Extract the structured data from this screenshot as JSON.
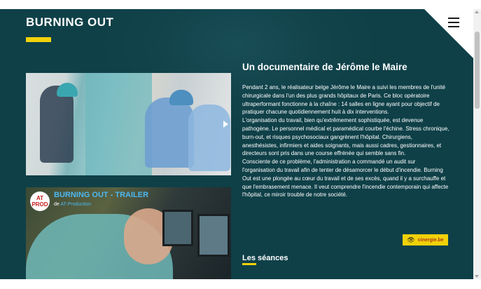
{
  "header": {
    "title": "BURNING OUT",
    "menu_icon": "hamburger-menu-icon"
  },
  "video_1": {
    "play_icon": "play-arrow-icon"
  },
  "video_2": {
    "channel_logo_line1": "AT",
    "channel_logo_line2": "PROD",
    "title": "BURNING OUT - TRAILER",
    "by_prefix": "de",
    "by_channel": "AT-Production"
  },
  "article": {
    "title": "Un documentaire de Jérôme le Maire",
    "paragraphs": [
      "Pendant 2 ans, le réalisateur belge Jérôme le Maire a suivi les membres de l'unité chirurgicale dans l'un des plus grands hôpitaux de Paris. Ce bloc opératoire ultraperformant fonctionne à la chaîne : 14 salles en ligne ayant pour objectif de pratiquer chacune quotidiennement huit à dix interventions.",
      "L'organisation du travail, bien qu'extrêmement sophistiquée, est devenue pathogène. Le personnel médical et paramédical courbe l'échine. Stress chronique, burn-out, et risques psychosociaux gangrènent l'hôpital. Chirurgiens, anesthésistes, infirmiers et aides soignants, mais aussi cadres, gestionnaires, et directeurs sont pris dans une course effrénée qui semble sans fin.",
      "Consciente de ce problème, l'administration a commandé un audit sur l'organisation du travail afin de tenter de désamorcer le début d'incendie. Burning Out est une plongée au cœur du travail et de ses excès, quand il y a surchauffe et que l'embrasement menace. Il veut comprendre l'incendie contemporain qui affecte l'hôpital, ce miroir trouble de notre société."
    ],
    "badge_icon": "eye-icon",
    "badge_label": "cinergie.be"
  },
  "seances": {
    "title": "Les séances"
  },
  "colors": {
    "background": "#0f4048",
    "accent_yellow": "#f1d10a",
    "text": "#ffffff",
    "link_blue": "#4db8f0"
  }
}
